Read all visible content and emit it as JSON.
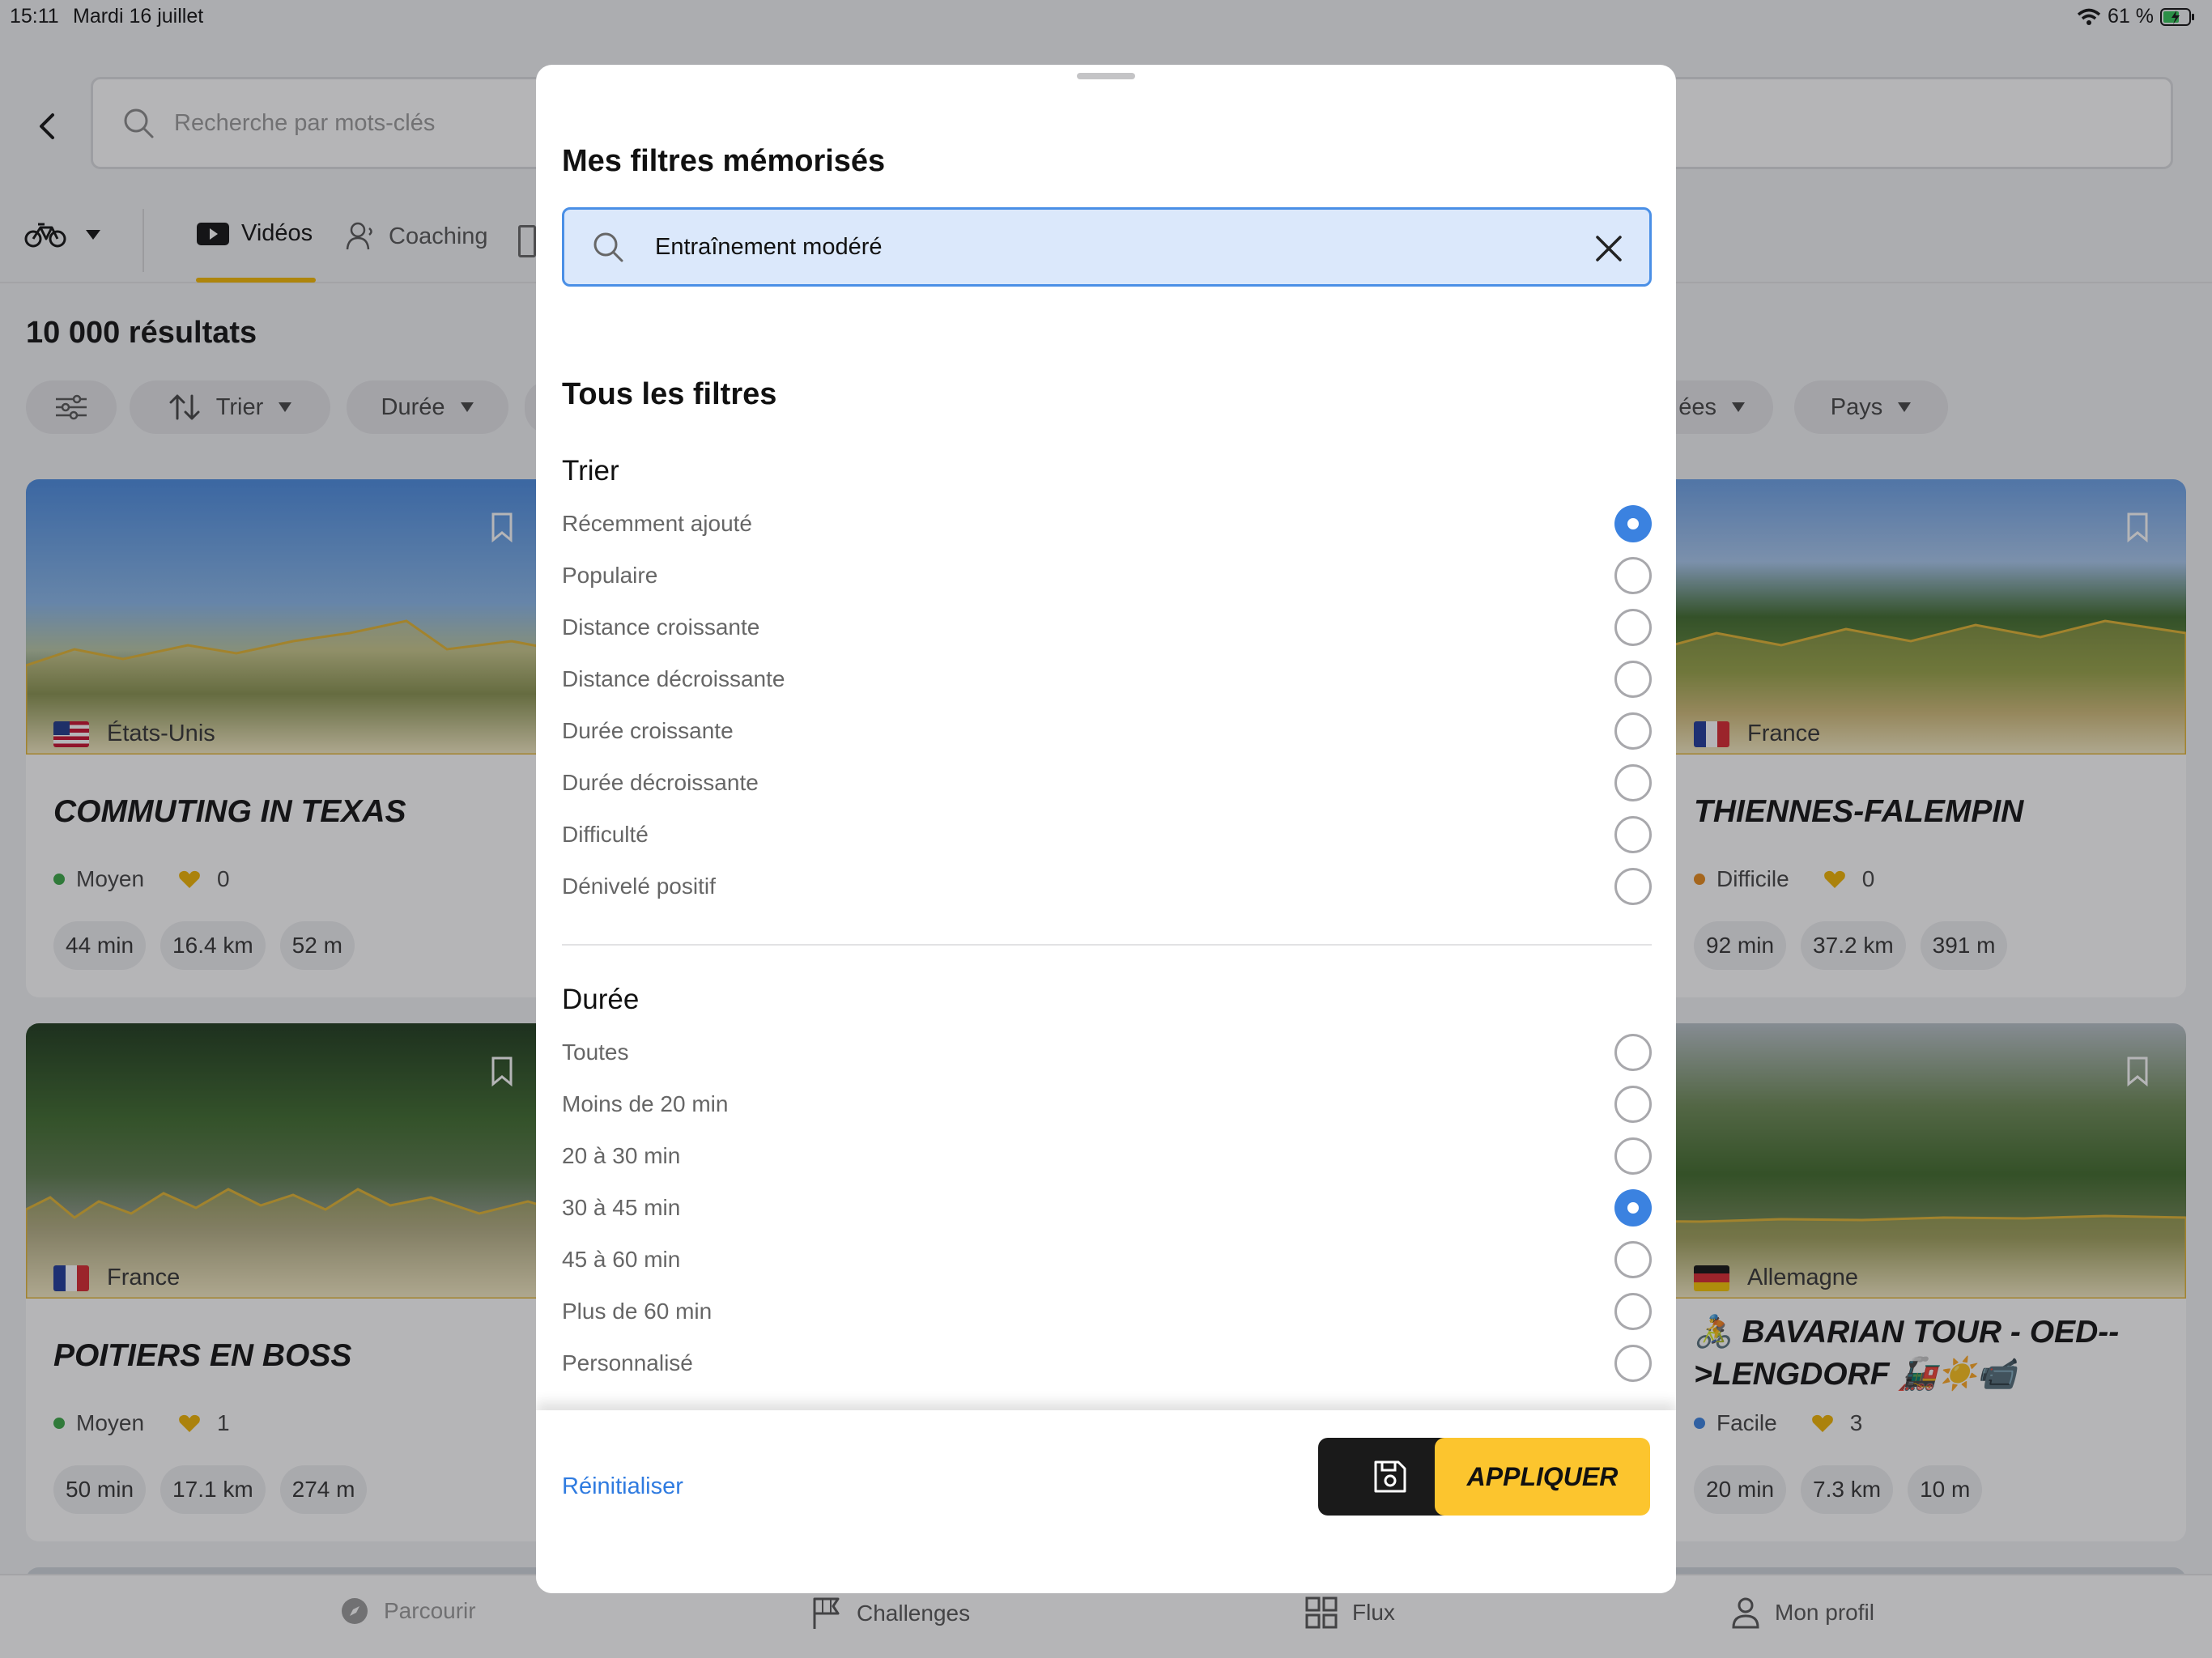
{
  "status": {
    "time": "15:11",
    "date": "Mardi 16 juillet",
    "battery": "61 %"
  },
  "header": {
    "search_placeholder": "Recherche par mots-clés"
  },
  "tabs": [
    {
      "label": "Vidéos",
      "active": true
    },
    {
      "label": "Coaching",
      "active": false
    }
  ],
  "results_count": "10 000 résultats",
  "filter_pills": {
    "sort": "Trier",
    "duration": "Durée",
    "partial": "ées",
    "country": "Pays"
  },
  "cards": [
    {
      "country": "États-Unis",
      "title": "COMMUTING IN TEXAS",
      "level": "Moyen",
      "level_color": "#3aa845",
      "likes": "0",
      "duration": "44 min",
      "distance": "16.4 km",
      "elevation": "52 m"
    },
    {
      "country": "France",
      "title": "THIENNES-FALEMPIN",
      "level": "Difficile",
      "level_color": "#e88a1a",
      "likes": "0",
      "duration": "92 min",
      "distance": "37.2 km",
      "elevation": "391 m"
    },
    {
      "country": "France",
      "title": "POITIERS EN BOSS",
      "level": "Moyen",
      "level_color": "#3aa845",
      "likes": "1",
      "duration": "50 min",
      "distance": "17.1 km",
      "elevation": "274 m"
    },
    {
      "country": "Allemagne",
      "title": "🚴 BAVARIAN TOUR - OED-->LENGDORF 🚂☀️📹",
      "level": "Facile",
      "level_color": "#3b82e0",
      "likes": "3",
      "duration": "20 min",
      "distance": "7.3 km",
      "elevation": "10 m"
    }
  ],
  "bottom_nav": [
    {
      "label": "Parcourir",
      "icon": "compass-icon"
    },
    {
      "label": "Challenges",
      "icon": "flag-icon"
    },
    {
      "label": "Flux",
      "icon": "grid-icon"
    },
    {
      "label": "Mon profil",
      "icon": "person-icon"
    }
  ],
  "modal": {
    "saved_title": "Mes filtres mémorisés",
    "saved_search_value": "Entraînement modéré",
    "all_filters_title": "Tous les filtres",
    "sort_section": "Trier",
    "sort_options": [
      {
        "label": "Récemment ajouté",
        "selected": true
      },
      {
        "label": "Populaire",
        "selected": false
      },
      {
        "label": "Distance croissante",
        "selected": false
      },
      {
        "label": "Distance décroissante",
        "selected": false
      },
      {
        "label": "Durée croissante",
        "selected": false
      },
      {
        "label": "Durée décroissante",
        "selected": false
      },
      {
        "label": "Difficulté",
        "selected": false
      },
      {
        "label": "Dénivelé positif",
        "selected": false
      }
    ],
    "duration_section": "Durée",
    "duration_options": [
      {
        "label": "Toutes",
        "selected": false
      },
      {
        "label": "Moins de 20 min",
        "selected": false
      },
      {
        "label": "20 à 30 min",
        "selected": false
      },
      {
        "label": "30 à 45 min",
        "selected": true
      },
      {
        "label": "45 à 60 min",
        "selected": false
      },
      {
        "label": "Plus de 60 min",
        "selected": false
      },
      {
        "label": "Personnalisé",
        "selected": false
      }
    ],
    "reset_label": "Réinitialiser",
    "apply_label": "APPLIQUER"
  },
  "colors": {
    "accent": "#fcc52e",
    "selected_radio": "#3b82e0",
    "link": "#2f7be0"
  }
}
